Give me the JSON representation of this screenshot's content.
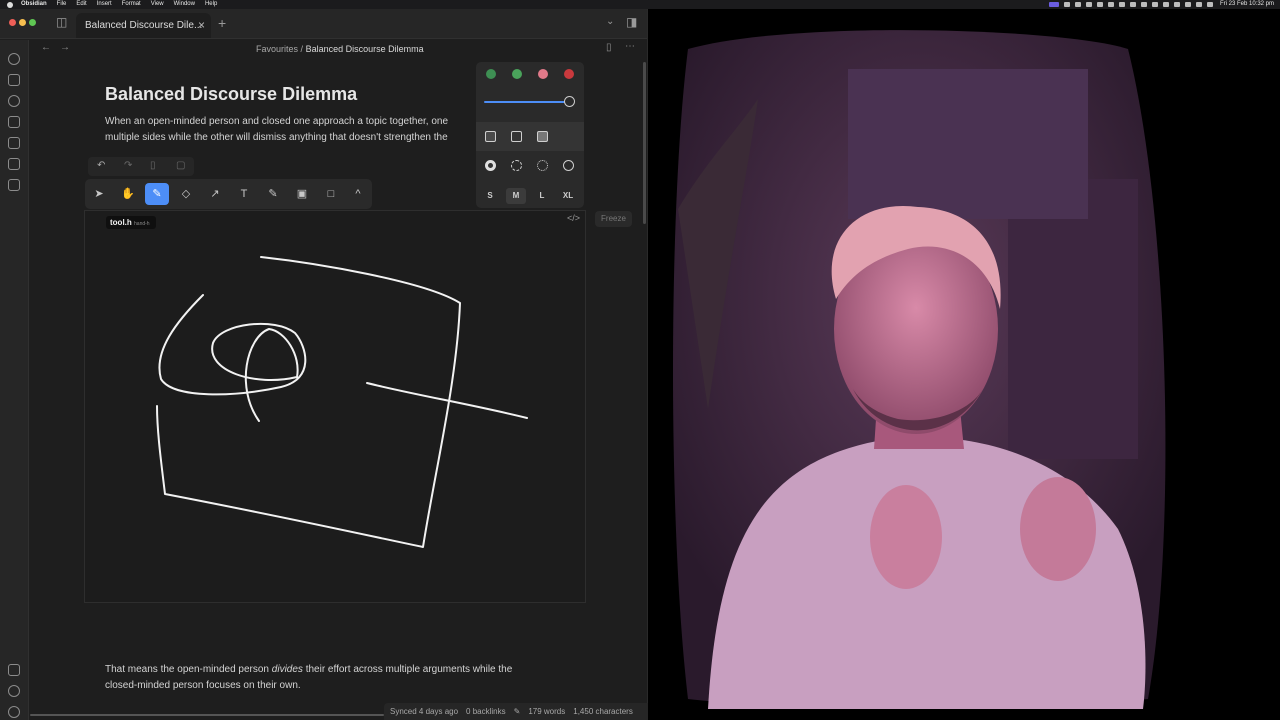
{
  "menubar": {
    "app_name": "Obsidian",
    "menus": [
      "File",
      "Edit",
      "Insert",
      "Format",
      "View",
      "Window",
      "Help"
    ],
    "datetime": "Fri 23 Feb  10:32 pm"
  },
  "window": {
    "tab_title": "Balanced Discourse Dile...",
    "new_tab": "+"
  },
  "breadcrumb": {
    "parent": "Favourites",
    "separator": "/",
    "current": "Balanced Discourse Dilemma"
  },
  "note": {
    "title": "Balanced Discourse Dilemma",
    "intro_line1": "When an open-minded person and closed one approach a topic together, one",
    "intro_line2": "multiple sides while the other will dismiss anything that doesn't strengthen the",
    "outro_line1_a": "That means the open-minded person ",
    "outro_line1_em": "divides",
    "outro_line1_b": " their effort across multiple arguments while the",
    "outro_line2": "closed-minded person focuses on their own."
  },
  "drawing": {
    "freeze_label": "Freeze",
    "code_toggle": "</>",
    "stroke_color": "#f2f2f2",
    "tools": [
      {
        "name": "select-tool",
        "icon": "pointer-icon",
        "glyph": "➤"
      },
      {
        "name": "hand-tool",
        "icon": "hand-icon",
        "glyph": "✋"
      },
      {
        "name": "draw-tool",
        "icon": "pencil-icon",
        "glyph": "✎"
      },
      {
        "name": "eraser-tool",
        "icon": "eraser-icon",
        "glyph": "◇"
      },
      {
        "name": "arrow-tool",
        "icon": "arrow-icon",
        "glyph": "↗"
      },
      {
        "name": "text-tool",
        "icon": "text-icon",
        "glyph": "T"
      },
      {
        "name": "note-tool",
        "icon": "note-icon",
        "glyph": "✎"
      },
      {
        "name": "image-tool",
        "icon": "image-icon",
        "glyph": "▣"
      },
      {
        "name": "rectangle-tool",
        "icon": "rectangle-icon",
        "glyph": "□"
      },
      {
        "name": "more-tools",
        "icon": "chevron-up-icon",
        "glyph": "^"
      }
    ],
    "active_tool": "draw-tool",
    "tooltip_text": "tool.h",
    "tooltip_key": "hand-h"
  },
  "style_panel": {
    "colors": [
      "#3e8f53",
      "#4aa35b",
      "#e17a8a",
      "#c9393d"
    ],
    "opacity": 1.0,
    "sizes": [
      "S",
      "M",
      "L",
      "XL"
    ],
    "active_size": "M"
  },
  "status": {
    "synced": "Synced 4 days ago",
    "backlinks": "0 backlinks",
    "words": "179 words",
    "characters": "1,450 characters"
  }
}
